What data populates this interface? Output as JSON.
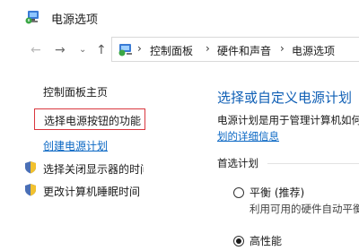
{
  "window": {
    "title": "电源选项",
    "icon": "power-options-icon"
  },
  "nav": {
    "back_icon": "arrow-left-icon",
    "forward_icon": "arrow-right-icon",
    "recent_icon": "chevron-down-icon",
    "up_icon": "arrow-up-icon",
    "breadcrumbs": [
      "控制面板",
      "硬件和声音",
      "电源选项"
    ],
    "separator": "›"
  },
  "sidebar": {
    "home": "控制面板主页",
    "choose_buttons": "选择电源按钮的功能",
    "create_plan": "创建电源计划",
    "display_off": "选择关闭显示器的时间",
    "sleep_time": "更改计算机睡眠时间"
  },
  "main": {
    "heading": "选择或自定义电源计划",
    "description": "电源计划是用于管理计算机如何使用电源的",
    "detail_link": "划的详细信息",
    "section_label": "首选计划",
    "plans": [
      {
        "name": "平衡 (推荐)",
        "description": "利用可用的硬件自动平衡功耗与性能",
        "selected": false
      },
      {
        "name": "高性能",
        "description": "",
        "selected": true
      }
    ]
  },
  "colors": {
    "accent_link": "#0a67c4",
    "heading": "#0f5fb5",
    "focus_border": "#d9363e"
  }
}
